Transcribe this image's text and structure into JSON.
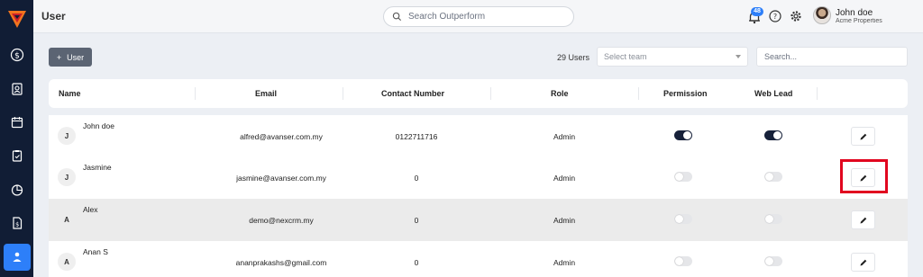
{
  "header": {
    "title": "User",
    "search_placeholder": "Search Outperform",
    "notification_count": "48",
    "user_name": "John doe",
    "user_company": "Acme Properties"
  },
  "toolbar": {
    "add_label": "User",
    "count_label": "29 Users",
    "team_placeholder": "Select team",
    "search_placeholder": "Search..."
  },
  "table": {
    "columns": [
      "Name",
      "Email",
      "Contact Number",
      "Role",
      "Permission",
      "Web Lead"
    ],
    "rows": [
      {
        "initial": "J",
        "name": "John doe",
        "email": "alfred@avanser.com.my",
        "contact": "0122711716",
        "role": "Admin",
        "permission": true,
        "web_lead": true
      },
      {
        "initial": "J",
        "name": "Jasmine",
        "email": "jasmine@avanser.com.my",
        "contact": "0",
        "role": "Admin",
        "permission": false,
        "web_lead": false
      },
      {
        "initial": "A",
        "name": "Alex",
        "email": "demo@nexcrm.my",
        "contact": "0",
        "role": "Admin",
        "permission": false,
        "web_lead": false
      },
      {
        "initial": "A",
        "name": "Anan S",
        "email": "ananprakashs@gmail.com",
        "contact": "0",
        "role": "Admin",
        "permission": false,
        "web_lead": false
      }
    ]
  },
  "colors": {
    "sidebar": "#111d35",
    "accent": "#2d7ff9",
    "toggle_on": "#17213a",
    "highlight": "#e1061f"
  },
  "icons": [
    "logo-icon",
    "dollar-icon",
    "contacts-icon",
    "calendar-icon",
    "clipboard-icon",
    "pie-chart-icon",
    "document-dollar-icon",
    "users-icon",
    "search-icon",
    "bell-icon",
    "help-icon",
    "gear-icon",
    "plus-icon",
    "pencil-icon"
  ]
}
